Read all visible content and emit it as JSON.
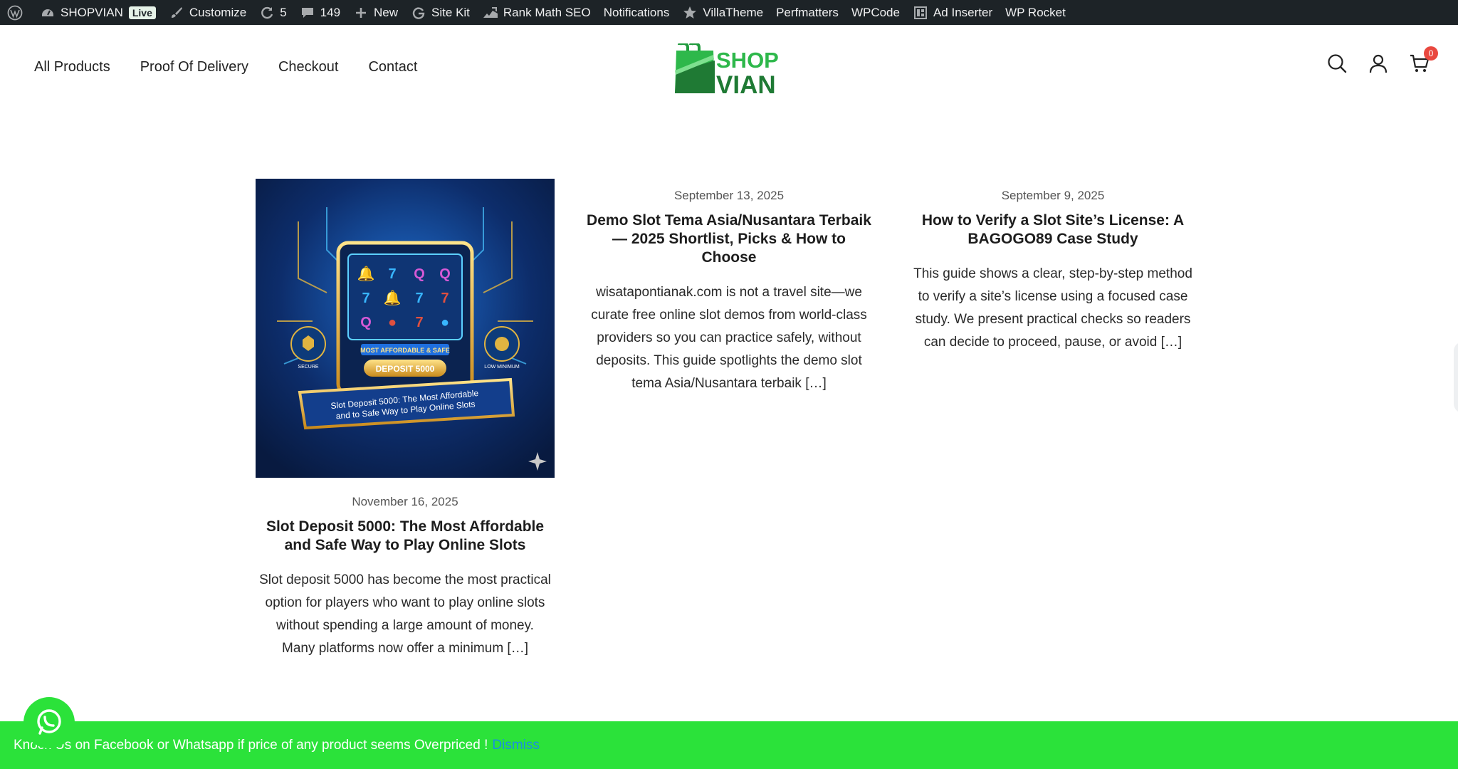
{
  "admin_bar": {
    "site_name": "SHOPVIAN",
    "live_badge": "Live",
    "customize": "Customize",
    "updates_count": "5",
    "comments_count": "149",
    "new": "New",
    "site_kit": "Site Kit",
    "rank_math": "Rank Math SEO",
    "notifications": "Notifications",
    "villatheme": "VillaTheme",
    "perfmatters": "Perfmatters",
    "wpcode": "WPCode",
    "ad_inserter": "Ad Inserter",
    "wp_rocket": "WP Rocket"
  },
  "nav": {
    "items": [
      "All Products",
      "Proof Of Delivery",
      "Checkout",
      "Contact"
    ]
  },
  "logo": {
    "line1": "SHOP",
    "line2": "VIAN",
    "colors": {
      "green": "#2eb84b",
      "dark_green": "#1f7a34"
    }
  },
  "header_icons": {
    "search": "search-icon",
    "account": "user-icon",
    "cart": "cart-icon",
    "cart_count": "0"
  },
  "posts": [
    {
      "date": "November 16, 2025",
      "title": "Slot Deposit 5000: The Most Affordable and Safe Way to Play Online Slots",
      "excerpt": "Slot deposit 5000 has become the most practical option for players who want to play online slots without spending a large amount of money. Many platforms now offer a minimum […]",
      "image": {
        "badge": "MOST AFFORDABLE & SAFE",
        "button": "DEPOSIT 5000",
        "ribbon_line1": "Slot Deposit 5000: The Most Affordable",
        "ribbon_line2": "and to Safe Way to Play Online Slots",
        "left_badge": "SECURE",
        "right_badge": "LOW MINIMUM"
      }
    },
    {
      "date": "September 13, 2025",
      "title": "Demo Slot Tema Asia/Nusantara Terbaik — 2025 Shortlist, Picks & How to Choose",
      "excerpt": "wisatapontianak.com is not a travel site—we curate free online slot demos from world-class providers so you can practice safely, without deposits. This guide spotlights the demo slot tema Asia/Nusantara terbaik […]"
    },
    {
      "date": "September 9, 2025",
      "title": "How to Verify a Slot Site’s License: A BAGOGO89 Case Study",
      "excerpt": "This guide shows a clear, step-by-step method to verify a site’s license using a focused case study. We present practical checks so readers can decide to proceed, pause, or avoid […]"
    }
  ],
  "notice": {
    "text": "Knock Us on Facebook or Whatsapp if price of any product seems Overpriced !",
    "dismiss": "Dismiss",
    "bg_color": "#2be23a"
  },
  "whatsapp": {
    "icon": "whatsapp-icon"
  }
}
